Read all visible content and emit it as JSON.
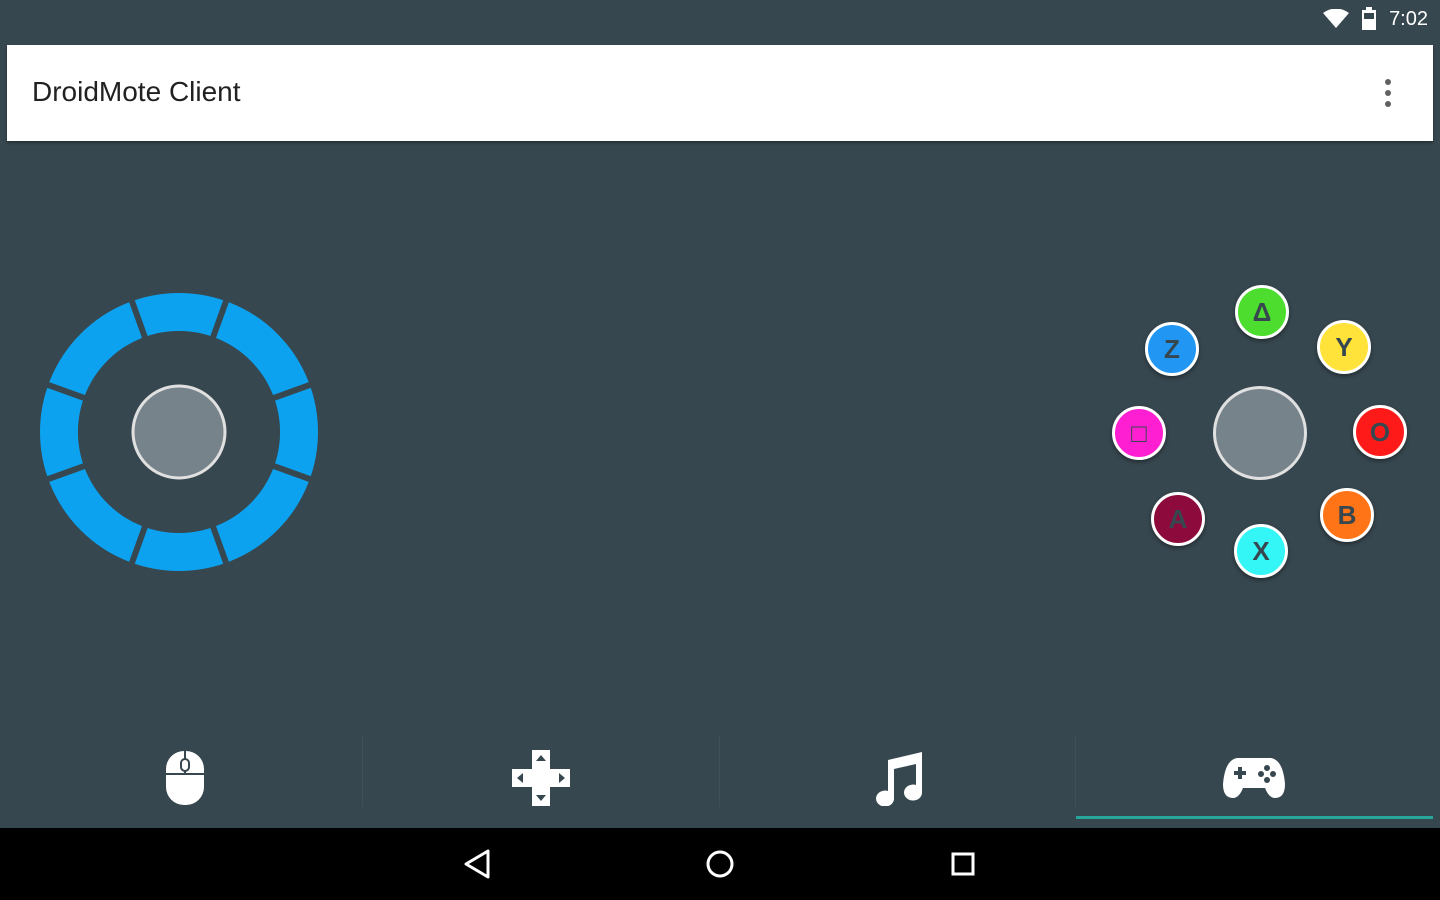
{
  "status_bar": {
    "time": "7:02",
    "icons": [
      "wifi-icon",
      "battery-icon"
    ]
  },
  "app_bar": {
    "title": "DroidMote Client",
    "menu_icon": "more-vert-icon"
  },
  "gamepad": {
    "buttons": [
      {
        "id": "triangle",
        "label": "Δ",
        "color": "#4cdd2e"
      },
      {
        "id": "y",
        "label": "Y",
        "color": "#ffe23a"
      },
      {
        "id": "z",
        "label": "Z",
        "color": "#2196f3"
      },
      {
        "id": "square",
        "label": "□",
        "color": "#ff1fd2"
      },
      {
        "id": "circle",
        "label": "O",
        "color": "#ff1a1a"
      },
      {
        "id": "a",
        "label": "A",
        "color": "#8c0a3c"
      },
      {
        "id": "b",
        "label": "B",
        "color": "#ff7416"
      },
      {
        "id": "x",
        "label": "X",
        "color": "#35f6f6"
      }
    ]
  },
  "joystick": {
    "ring_color": "#0da2f0",
    "knob_color": "#77838a"
  },
  "tabs": [
    {
      "id": "mouse",
      "icon": "mouse-icon",
      "selected": false
    },
    {
      "id": "dpad",
      "icon": "dpad-icon",
      "selected": false
    },
    {
      "id": "music",
      "icon": "music-note-icon",
      "selected": false
    },
    {
      "id": "gamepad",
      "icon": "gamepad-icon",
      "selected": true
    }
  ],
  "tab_indicator_color": "#26a69a",
  "nav_bar": {
    "buttons": [
      "back-icon",
      "home-icon",
      "recents-icon"
    ]
  }
}
